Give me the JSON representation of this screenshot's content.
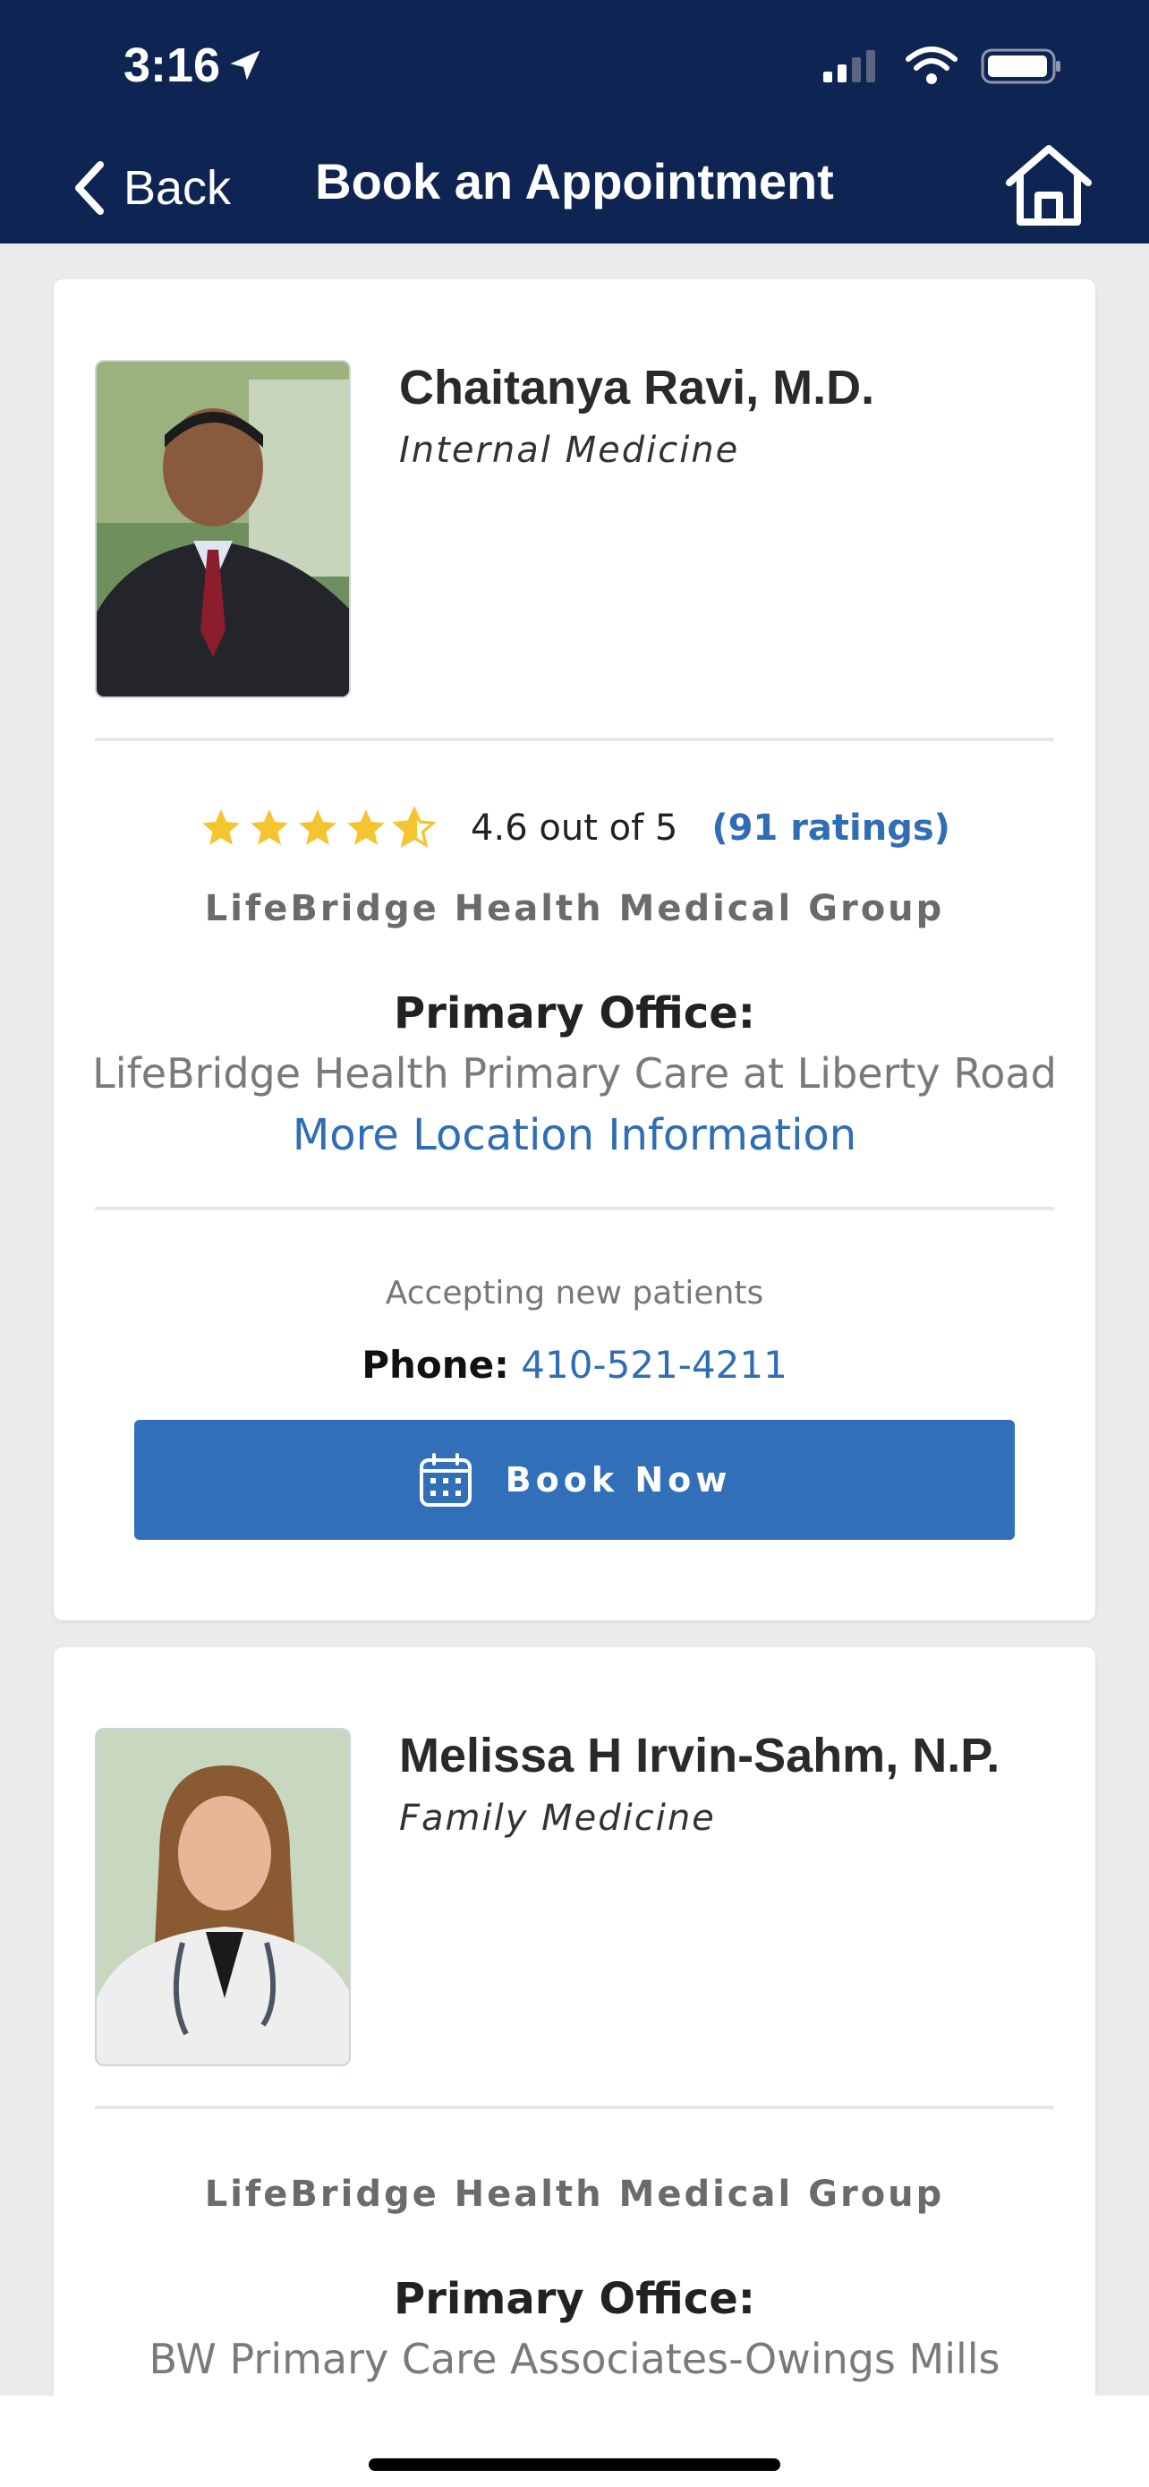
{
  "status_bar": {
    "time": "3:16"
  },
  "nav": {
    "back_label": "Back",
    "title": "Book an Appointment"
  },
  "providers": [
    {
      "name": "Chaitanya Ravi, M.D.",
      "specialty": "Internal Medicine",
      "rating": {
        "stars": 4.6,
        "text": "4.6 out of 5",
        "count_label": "(91 ratings)"
      },
      "group": "LifeBridge Health Medical Group",
      "office_label": "Primary Office:",
      "office_name": "LifeBridge Health Primary Care at Liberty Road",
      "more_location": "More Location Information",
      "accepting": "Accepting new patients",
      "phone_label": "Phone:",
      "phone": "410-521-4211",
      "book_label": "Book Now"
    },
    {
      "name": "Melissa H Irvin-Sahm, N.P.",
      "specialty": "Family Medicine",
      "group": "LifeBridge Health Medical Group",
      "office_label": "Primary Office:",
      "office_name": "BW Primary Care Associates-Owings Mills"
    }
  ],
  "colors": {
    "header_bg": "#0e2553",
    "accent_blue": "#316fb8",
    "link_blue": "#2f6db5",
    "star_yellow": "#f5c431",
    "page_bg": "#ebebed"
  },
  "icons": {
    "location": "location-arrow-icon",
    "back": "chevron-left-icon",
    "home": "home-icon",
    "calendar": "calendar-icon"
  }
}
